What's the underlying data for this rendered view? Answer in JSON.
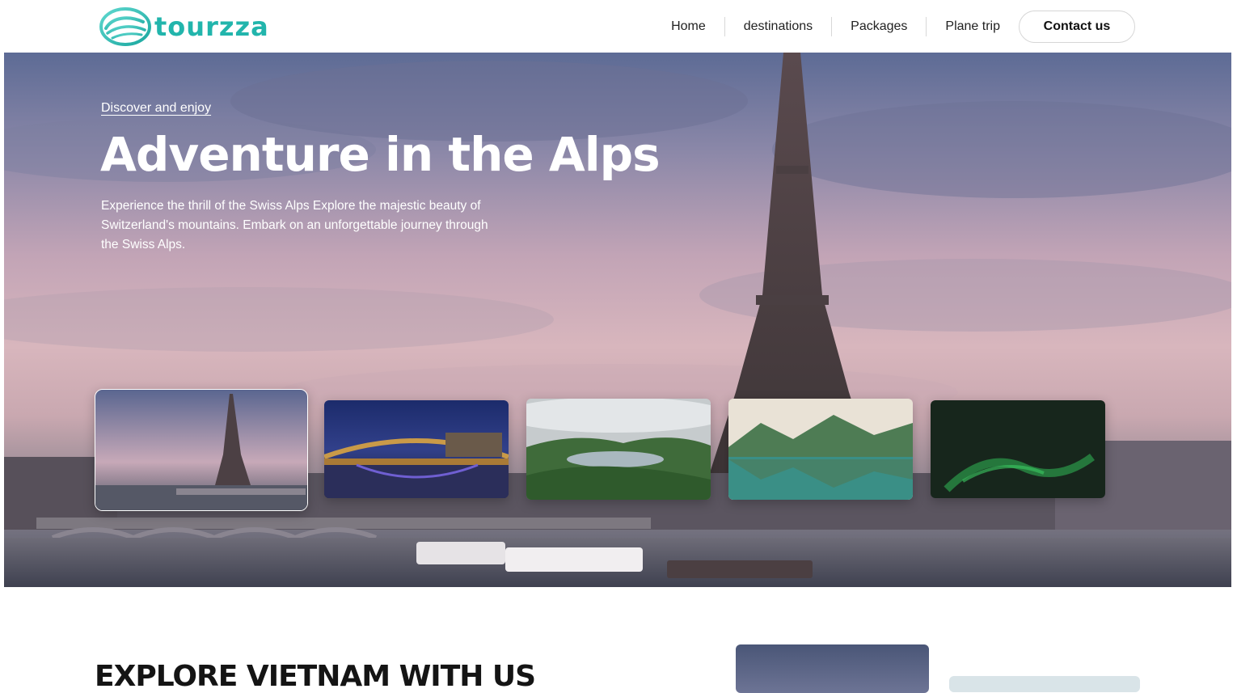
{
  "header": {
    "brand": "tourzza",
    "nav": [
      {
        "label": "Home"
      },
      {
        "label": "destinations"
      },
      {
        "label": "Packages"
      },
      {
        "label": "Plane trip"
      }
    ],
    "contact_label": "Contact us"
  },
  "hero": {
    "eyebrow": "Discover and enjoy",
    "title": "Adventure in the Alps",
    "description": "Experience the thrill of the Swiss Alps Explore the majestic beauty of Switzerland's mountains. Embark on an unforgettable journey through the Swiss Alps.",
    "thumbnails": [
      {
        "subject": "eiffel-tower-river",
        "active": true
      },
      {
        "subject": "bridge-at-night",
        "active": false
      },
      {
        "subject": "crater-lake-valley",
        "active": false
      },
      {
        "subject": "mountain-lake-reflection",
        "active": false
      },
      {
        "subject": "northern-lights",
        "active": false
      }
    ]
  },
  "explore": {
    "title": "EXPLORE VIETNAM WITH US"
  },
  "colors": {
    "brand": "#22b5ac",
    "text": "#1a1a1a"
  }
}
